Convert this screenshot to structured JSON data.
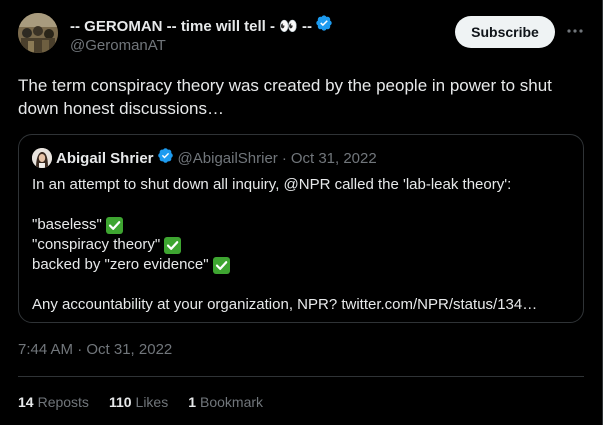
{
  "colors": {
    "background": "#000000",
    "text_primary": "#e7e9ea",
    "text_secondary": "#71767b",
    "border": "#2f3336",
    "verified_blue": "#1d9bf0",
    "check_green": "#3ea531",
    "subscribe_bg": "#eff3f4"
  },
  "author": {
    "display_name": "-- GEROMAN -- time will tell - 👀 --",
    "handle": "@GeromanAT",
    "verified_icon": "verified-badge-icon",
    "avatar_icon": "avatar"
  },
  "actions": {
    "subscribe_label": "Subscribe",
    "more_icon": "more-horizontal-icon"
  },
  "tweet": {
    "text": "The term conspiracy theory was created by the people in power to shut down honest discussions…",
    "timestamp": "7:44 AM · Oct 31, 2022"
  },
  "quote": {
    "display_name": "Abigail Shrier",
    "handle": "@AbigailShrier",
    "separator": "·",
    "date": "Oct 31, 2022",
    "lines": [
      "In an attempt to shut down all inquiry, @NPR called the 'lab-leak theory':",
      "",
      "\"baseless\"",
      "\"conspiracy theory\"",
      "backed by \"zero evidence\"",
      "",
      "Any accountability at your organization, NPR? twitter.com/NPR/status/134…"
    ],
    "check_icon": "check-mark-button-icon"
  },
  "stats": [
    {
      "count": "14",
      "label": "Reposts"
    },
    {
      "count": "110",
      "label": "Likes"
    },
    {
      "count": "1",
      "label": "Bookmark"
    }
  ]
}
